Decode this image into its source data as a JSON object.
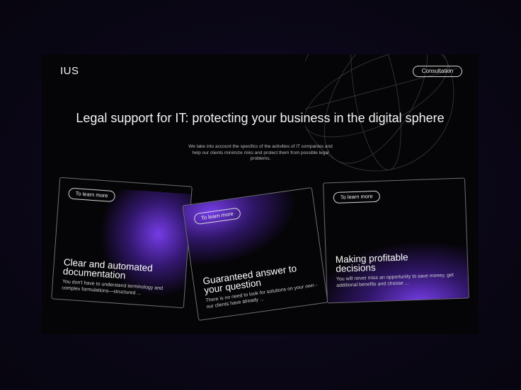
{
  "header": {
    "logo": "IUS",
    "consultation_label": "Consultation"
  },
  "hero": {
    "headline": "Legal support for IT: protecting your business in the digital sphere",
    "lead": "We take into account the specifics of the activities of IT companies and help our clients minimize risks and protect them from possible legal problems."
  },
  "cards": [
    {
      "button_label": "To learn more",
      "title": "Clear and automated documentation",
      "description": "You don't have to understand terminology and complex formulations—structured ..."
    },
    {
      "button_label": "To learn more",
      "title": "Guaranteed answer to your question",
      "description": "There is no need to look for solutions on your own - our clients have already ..."
    },
    {
      "button_label": "To learn more",
      "title": "Making profitable decisions",
      "description": "You will never miss an opportunity to save money, get additional benefits and choose ..."
    }
  ],
  "colors": {
    "accent": "#7b3ff2",
    "background": "#050406",
    "page_backdrop": "#0b0718"
  },
  "icons": [
    "globe-wireframe-icon"
  ]
}
